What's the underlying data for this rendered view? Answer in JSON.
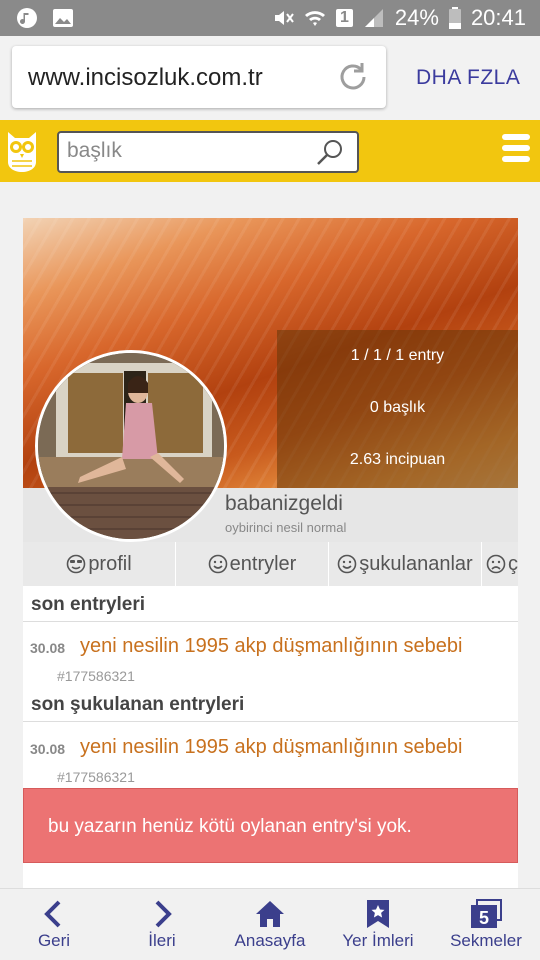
{
  "status": {
    "battery": "24%",
    "time": "20:41",
    "sim": "1"
  },
  "browser": {
    "url": "www.incisozluk.com.tr",
    "dha_label": "DHA FZLA"
  },
  "site": {
    "search_placeholder": "başlık"
  },
  "profile": {
    "stats": [
      "1 / 1 / 1 entry",
      "0 başlık",
      "2.63 incipuan"
    ],
    "username": "babanizgeldi",
    "rank": "oybirinci nesil normal"
  },
  "tabs": [
    "profil",
    "entryler",
    "şukulananlar",
    "ç"
  ],
  "sections": [
    {
      "title": "son entryleri",
      "entries": [
        {
          "date": "30.08",
          "title": "yeni nesilin 1995 akp düşmanlığının sebebi",
          "id": "#177586321"
        }
      ]
    },
    {
      "title": "son şukulanan entryleri",
      "entries": [
        {
          "date": "30.08",
          "title": "yeni nesilin 1995 akp düşmanlığının sebebi",
          "id": "#177586321"
        }
      ]
    }
  ],
  "alert": "bu yazarın henüz kötü oylanan entry'si yok.",
  "bottom_nav": [
    "Geri",
    "İleri",
    "Anasayfa",
    "Yer İmleri",
    "Sekmeler"
  ],
  "tab_count": "5",
  "colors": {
    "site_bar": "#f2c60f",
    "link": "#c8711e",
    "alert": "#ec7373",
    "nav": "#3b3f8c"
  }
}
